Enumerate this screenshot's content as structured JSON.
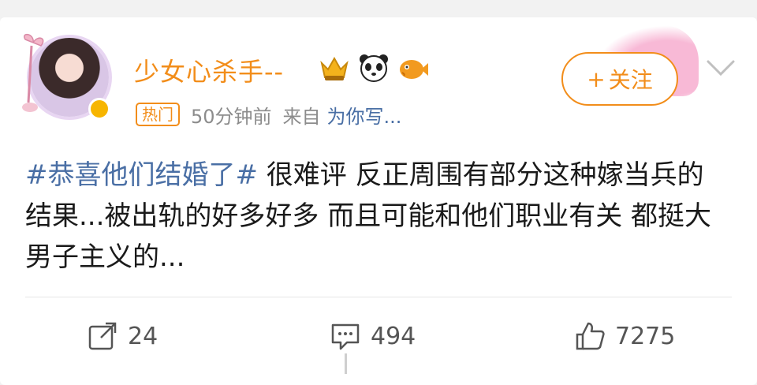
{
  "post": {
    "username": "少女心杀手--",
    "hot_tag": "热门",
    "time": "50分钟前",
    "source_prefix": "来自",
    "source": "为你写...",
    "follow_label": "关注",
    "topic": "#恭喜他们结婚了#",
    "text": " 很难评 反正周围有部分这种嫁当兵的 结果...被出轨的好多好多 而且可能和他们职业有关 都挺大男子主义的..."
  },
  "badges": [
    "crown-badge-icon",
    "panda-badge-icon",
    "fish-badge-icon"
  ],
  "actions": {
    "repost_count": "24",
    "comment_count": "494",
    "like_count": "7275"
  },
  "colors": {
    "accent": "#f28d1a",
    "link": "#4a6fa5",
    "text": "#1a1a1a",
    "muted": "#8c8c8c"
  }
}
